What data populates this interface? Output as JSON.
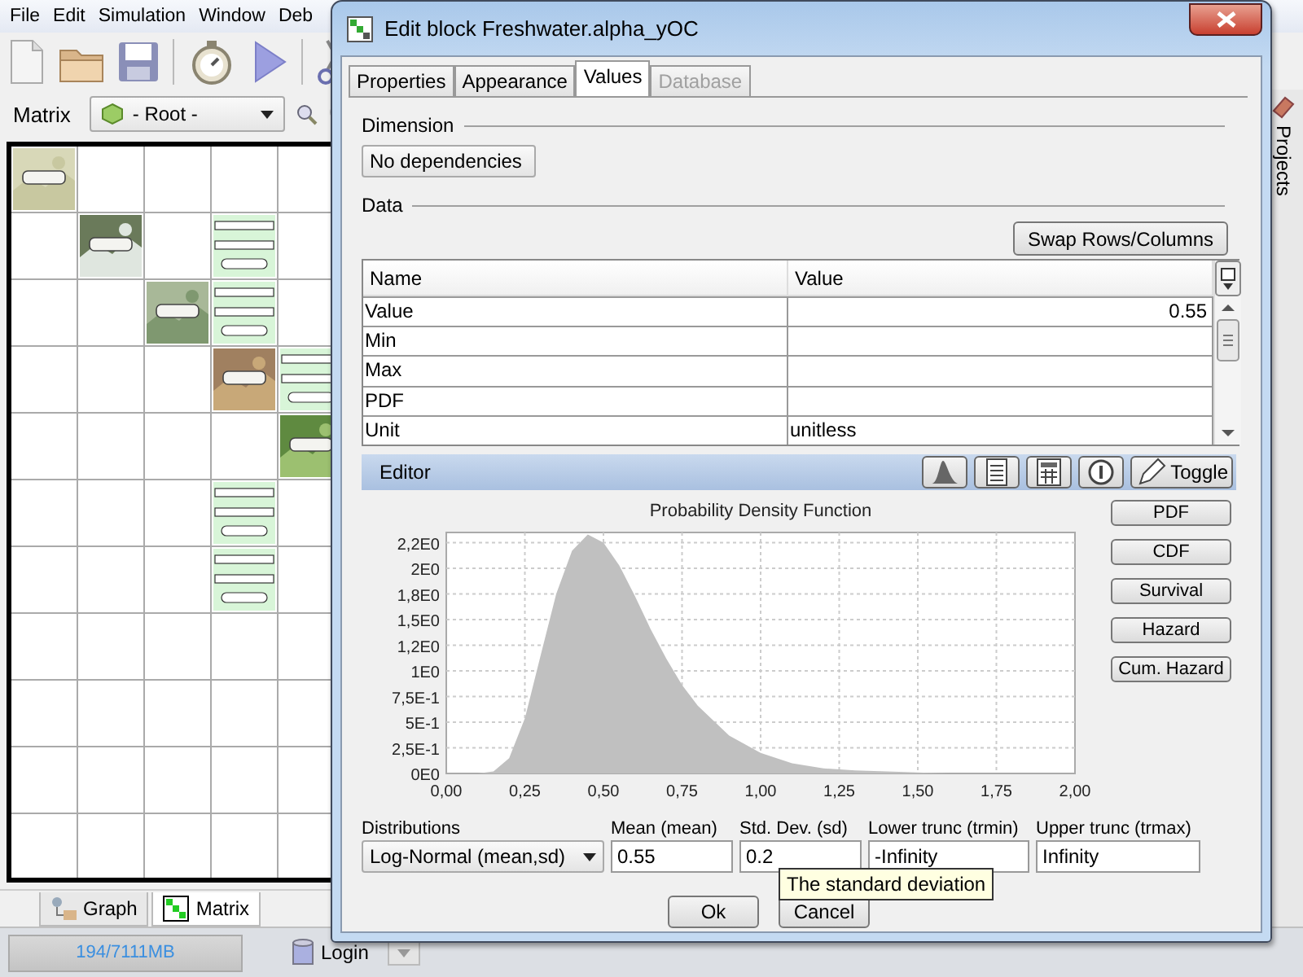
{
  "app": {
    "menu": [
      {
        "label": "File"
      },
      {
        "label": "Edit"
      },
      {
        "label": "Simulation"
      },
      {
        "label": "Window"
      },
      {
        "label": "Deb"
      }
    ],
    "matrix_panel": {
      "label": "Matrix",
      "root_select": "- Root -",
      "grid": [
        [
          {
            "kind": "picture"
          },
          {
            "kind": "empty"
          },
          {
            "kind": "empty"
          },
          {
            "kind": "empty"
          },
          {
            "kind": "empty"
          }
        ],
        [
          {
            "kind": "empty"
          },
          {
            "kind": "picture"
          },
          {
            "kind": "empty"
          },
          {
            "kind": "note"
          },
          {
            "kind": "empty"
          }
        ],
        [
          {
            "kind": "empty"
          },
          {
            "kind": "empty"
          },
          {
            "kind": "picture"
          },
          {
            "kind": "note"
          },
          {
            "kind": "empty"
          }
        ],
        [
          {
            "kind": "empty"
          },
          {
            "kind": "empty"
          },
          {
            "kind": "empty"
          },
          {
            "kind": "picture"
          },
          {
            "kind": "note"
          }
        ],
        [
          {
            "kind": "empty"
          },
          {
            "kind": "empty"
          },
          {
            "kind": "empty"
          },
          {
            "kind": "empty"
          },
          {
            "kind": "picture"
          }
        ],
        [
          {
            "kind": "empty"
          },
          {
            "kind": "empty"
          },
          {
            "kind": "empty"
          },
          {
            "kind": "note"
          },
          {
            "kind": "empty"
          }
        ],
        [
          {
            "kind": "empty"
          },
          {
            "kind": "empty"
          },
          {
            "kind": "empty"
          },
          {
            "kind": "note"
          },
          {
            "kind": "empty"
          }
        ],
        [
          {
            "kind": "empty"
          },
          {
            "kind": "empty"
          },
          {
            "kind": "empty"
          },
          {
            "kind": "empty"
          },
          {
            "kind": "empty"
          }
        ],
        [
          {
            "kind": "empty"
          },
          {
            "kind": "empty"
          },
          {
            "kind": "empty"
          },
          {
            "kind": "empty"
          },
          {
            "kind": "empty"
          }
        ],
        [
          {
            "kind": "empty"
          },
          {
            "kind": "empty"
          },
          {
            "kind": "empty"
          },
          {
            "kind": "empty"
          },
          {
            "kind": "empty"
          }
        ],
        [
          {
            "kind": "empty"
          },
          {
            "kind": "empty"
          },
          {
            "kind": "empty"
          },
          {
            "kind": "empty"
          },
          {
            "kind": "empty"
          }
        ]
      ],
      "tabs": [
        {
          "label": "Graph",
          "selected": false
        },
        {
          "label": "Matrix",
          "selected": true
        }
      ]
    },
    "side_tab": {
      "label": "Projects"
    },
    "status_bar": {
      "memory": "194/7111MB",
      "login": "Login"
    }
  },
  "dialog": {
    "title": "Edit block Freshwater.alpha_yOC",
    "tabs": [
      {
        "label": "Properties",
        "selected": false,
        "disabled": false
      },
      {
        "label": "Appearance",
        "selected": false,
        "disabled": false
      },
      {
        "label": "Values",
        "selected": true,
        "disabled": false
      },
      {
        "label": "Database",
        "selected": false,
        "disabled": true
      }
    ],
    "dimension": {
      "heading": "Dimension",
      "select": "No dependencies"
    },
    "data": {
      "heading": "Data",
      "swap_button": "Swap Rows/Columns",
      "columns": [
        "Name",
        "Value"
      ],
      "rows": [
        {
          "name": "Value",
          "value": "0.55"
        },
        {
          "name": "Min"
        },
        {
          "name": "Max"
        },
        {
          "name": "PDF"
        },
        {
          "name": "Unit",
          "value": "unitless"
        }
      ]
    },
    "editor": {
      "title": "Editor",
      "toggle": "Toggle",
      "chart_data": {
        "type": "area",
        "title": "Probability Density Function",
        "x": [
          0,
          0.1,
          0.15,
          0.2,
          0.25,
          0.3,
          0.35,
          0.4,
          0.45,
          0.5,
          0.55,
          0.6,
          0.65,
          0.7,
          0.75,
          0.8,
          0.9,
          1.0,
          1.1,
          1.2,
          1.3,
          1.4,
          1.5,
          1.6,
          1.7,
          1.8,
          1.9,
          2.0
        ],
        "series": [
          {
            "color": "#c0c0c0",
            "values": [
              0,
              0,
              0.02,
              0.15,
              0.54,
              1.15,
              1.75,
              2.17,
              2.33,
              2.25,
              2.03,
              1.73,
              1.41,
              1.12,
              0.86,
              0.66,
              0.37,
              0.2,
              0.1,
              0.05,
              0.03,
              0.02,
              0.01,
              0,
              0,
              0,
              0,
              0
            ]
          }
        ],
        "xlim": [
          0,
          2
        ],
        "ylim": [
          0,
          2.35
        ],
        "grid": true,
        "xticks": [
          {
            "value": 0,
            "label": "0,00"
          },
          {
            "value": 0.25,
            "label": "0,25"
          },
          {
            "value": 0.5,
            "label": "0,50"
          },
          {
            "value": 0.75,
            "label": "0,75"
          },
          {
            "value": 1,
            "label": "1,00"
          },
          {
            "value": 1.25,
            "label": "1,25"
          },
          {
            "value": 1.5,
            "label": "1,50"
          },
          {
            "value": 1.75,
            "label": "1,75"
          },
          {
            "value": 2,
            "label": "2,00"
          }
        ],
        "yticks": [
          {
            "value": 0,
            "label": "0E0"
          },
          {
            "value": 0.25,
            "label": "2,5E-1"
          },
          {
            "value": 0.5,
            "label": "5E-1"
          },
          {
            "value": 0.75,
            "label": "7,5E-1"
          },
          {
            "value": 1,
            "label": "1E0"
          },
          {
            "value": 1.25,
            "label": "1,2E0"
          },
          {
            "value": 1.5,
            "label": "1,5E0"
          },
          {
            "value": 1.75,
            "label": "1,8E0"
          },
          {
            "value": 2,
            "label": "2E0"
          },
          {
            "value": 2.25,
            "label": "2,2E0"
          }
        ]
      },
      "function_buttons": [
        "PDF",
        "CDF",
        "Survival",
        "Hazard",
        "Cum. Hazard"
      ]
    },
    "fields": [
      {
        "label": "Distributions",
        "kind": "select",
        "value": "Log-Normal (mean,sd)"
      },
      {
        "label": "Mean (mean)",
        "kind": "input",
        "value": "0.55"
      },
      {
        "label": "Std. Dev. (sd)",
        "kind": "input",
        "value": "0.2"
      },
      {
        "label": "Lower trunc (trmin)",
        "kind": "input",
        "value": "-Infinity"
      },
      {
        "label": "Upper trunc (trmax)",
        "kind": "input",
        "value": "Infinity"
      }
    ],
    "tooltip": "The standard deviation",
    "buttons": [
      "Ok",
      "Cancel"
    ]
  }
}
